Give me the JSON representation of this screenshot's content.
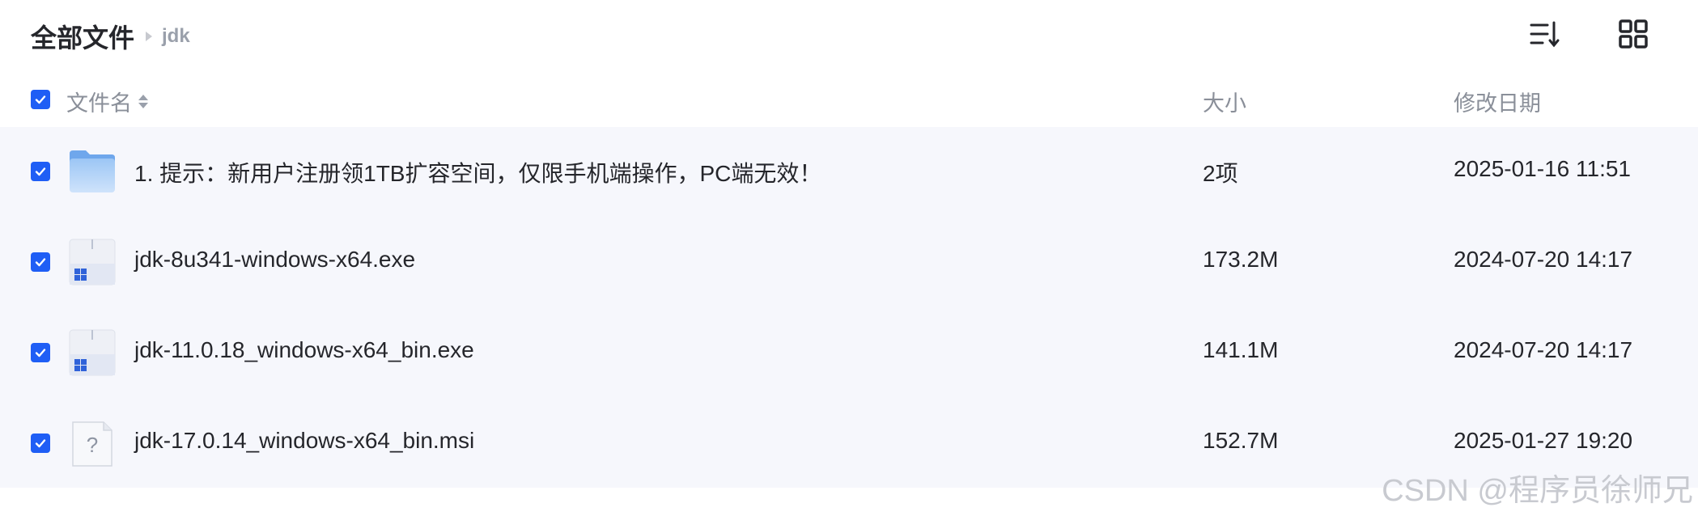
{
  "breadcrumb": {
    "root": "全部文件",
    "current": "jdk"
  },
  "toolbar": {
    "sort_icon": "sort-list-icon",
    "view_icon": "grid-view-icon"
  },
  "columns": {
    "name": "文件名",
    "size": "大小",
    "date": "修改日期"
  },
  "colors": {
    "accent": "#1f5ef5",
    "row_bg": "#f6f7fc",
    "header_text": "#8a8f99"
  },
  "files": [
    {
      "name": "1. 提示：新用户注册领1TB扩容空间，仅限手机端操作，PC端无效！",
      "size": "2项",
      "date": "2025-01-16 11:51",
      "icon": "folder-icon",
      "checked": true
    },
    {
      "name": "jdk-8u341-windows-x64.exe",
      "size": "173.2M",
      "date": "2024-07-20 14:17",
      "icon": "windows-exe-icon",
      "checked": true
    },
    {
      "name": "jdk-11.0.18_windows-x64_bin.exe",
      "size": "141.1M",
      "date": "2024-07-20 14:17",
      "icon": "windows-exe-icon",
      "checked": true
    },
    {
      "name": "jdk-17.0.14_windows-x64_bin.msi",
      "size": "152.7M",
      "date": "2025-01-27 19:20",
      "icon": "unknown-file-icon",
      "checked": true
    }
  ],
  "watermark": "CSDN @程序员徐师兄"
}
